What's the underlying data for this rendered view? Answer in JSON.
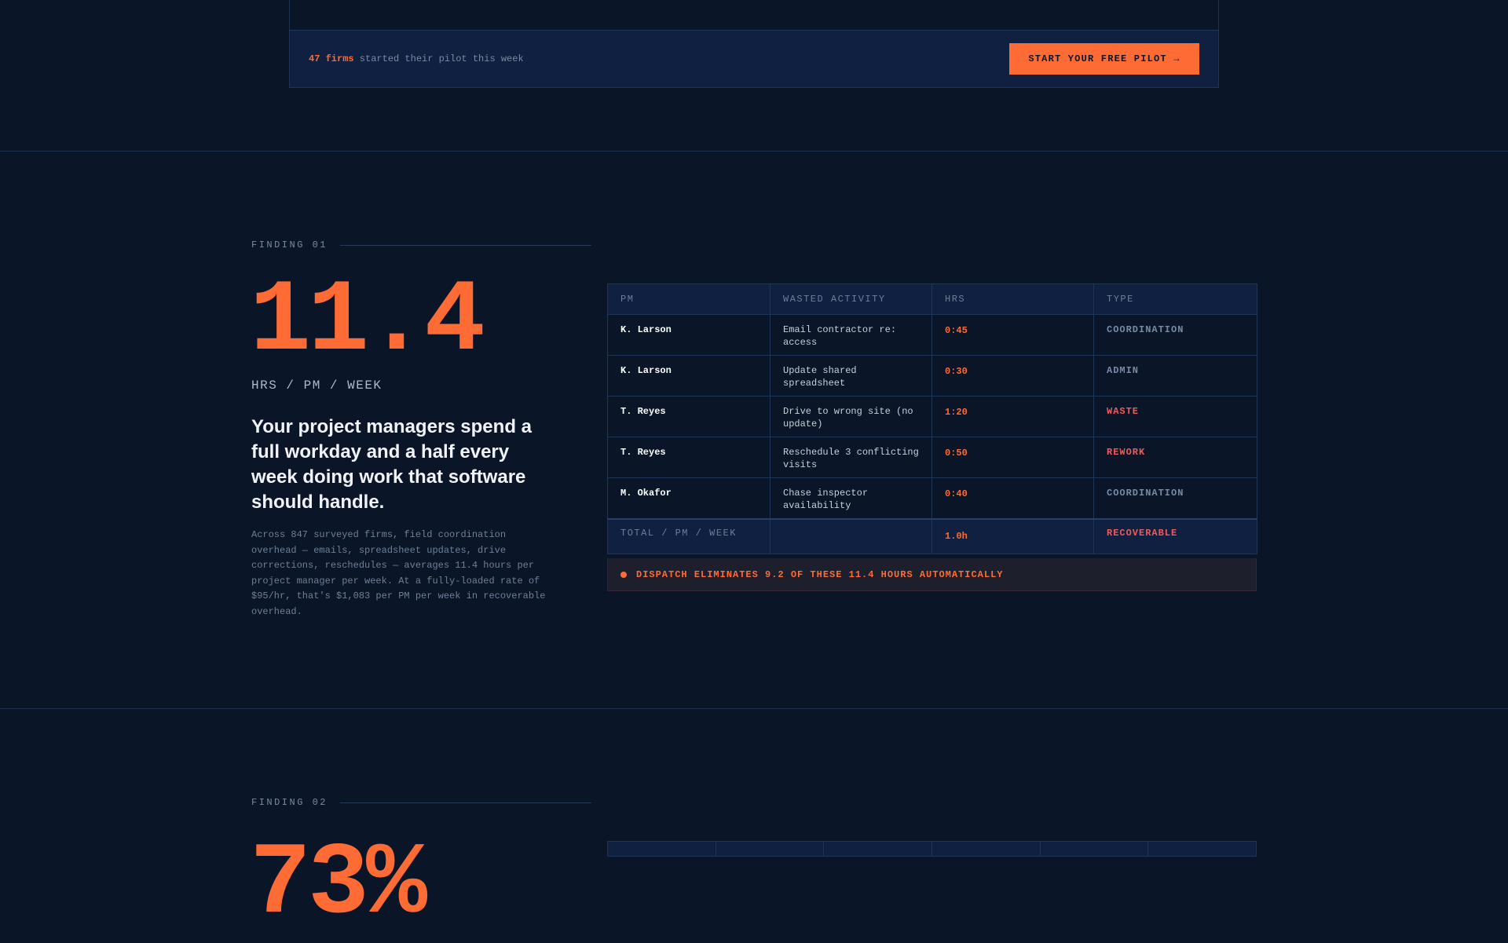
{
  "banner": {
    "count_highlight": "47 firms",
    "count_text": " started their pilot this week",
    "cta_label": "START YOUR FREE PILOT →"
  },
  "finding1": {
    "label": "FINDING 01",
    "value": "11.4",
    "unit": "HRS / PM / WEEK",
    "headline": "Your project managers spend a full workday and a half every week doing work that software should handle.",
    "body": "Across 847 surveyed firms, field coordination overhead — emails, spreadsheet updates, drive corrections, reschedules — averages 11.4 hours per project manager per week. At a fully-loaded rate of $95/hr, that's $1,083 per PM per week in recoverable overhead.",
    "table": {
      "headers": [
        "PM",
        "WASTED ACTIVITY",
        "HRS",
        "TYPE"
      ],
      "rows": [
        {
          "pm": "K. Larson",
          "activity": "Email contractor re: access",
          "hrs": "0:45",
          "type": "COORDINATION"
        },
        {
          "pm": "K. Larson",
          "activity": "Update shared spreadsheet",
          "hrs": "0:30",
          "type": "ADMIN"
        },
        {
          "pm": "T. Reyes",
          "activity": "Drive to wrong site (no update)",
          "hrs": "1:20",
          "type": "WASTE"
        },
        {
          "pm": "T. Reyes",
          "activity": "Reschedule 3 conflicting visits",
          "hrs": "0:50",
          "type": "REWORK"
        },
        {
          "pm": "M. Okafor",
          "activity": "Chase inspector availability",
          "hrs": "0:40",
          "type": "COORDINATION"
        }
      ],
      "footer": {
        "label": "TOTAL / PM / WEEK",
        "activity": "",
        "hrs": "1.0h",
        "type": "RECOVERABLE"
      }
    },
    "dispatch_note": "DISPATCH ELIMINATES 9.2 OF THESE 11.4 HOURS AUTOMATICALLY"
  },
  "finding2": {
    "label": "FINDING 02",
    "value": "73%"
  },
  "colors": {
    "background": "#0a1628",
    "accent": "#ff6b35",
    "warn": "#f05a5a",
    "panel": "#0f2040"
  }
}
